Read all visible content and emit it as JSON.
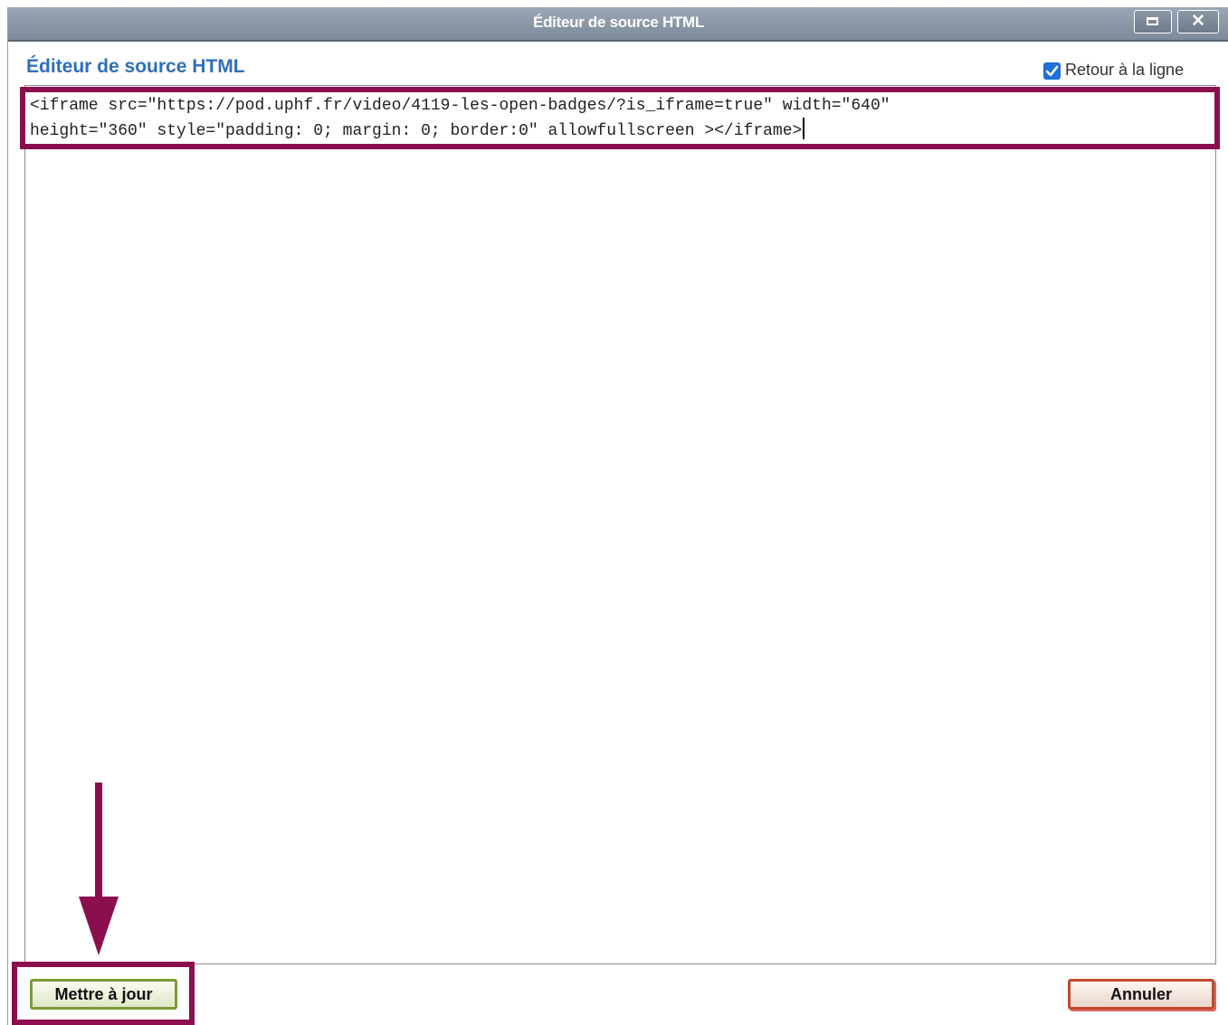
{
  "window": {
    "title": "Éditeur de source HTML"
  },
  "editor": {
    "heading": "Éditeur de source HTML",
    "wrap_label": "Retour à la ligne",
    "wrap_checked": true,
    "source_line_1": "<iframe src=\"https://pod.uphf.fr/video/4119-les-open-badges/?is_iframe=true\" width=\"640\"",
    "source_line_2": "height=\"360\" style=\"padding: 0; margin: 0; border:0\" allowfullscreen ></iframe>"
  },
  "buttons": {
    "update_label": "Mettre à jour",
    "cancel_label": "Annuler"
  },
  "colors": {
    "annotation": "#8c0f4d",
    "heading": "#2f6fb8",
    "checkbox": "#1f6fd6"
  }
}
